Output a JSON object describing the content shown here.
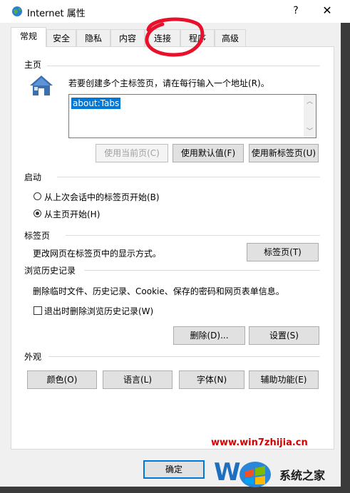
{
  "window": {
    "title": "Internet 属性",
    "help_label": "?",
    "close_label": "✕"
  },
  "tabs": [
    {
      "label": "常规",
      "active": true
    },
    {
      "label": "安全"
    },
    {
      "label": "隐私"
    },
    {
      "label": "内容"
    },
    {
      "label": "连接"
    },
    {
      "label": "程序"
    },
    {
      "label": "高级"
    }
  ],
  "homepage": {
    "title": "主页",
    "description": "若要创建多个主标签页，请在每行输入一个地址(R)。",
    "value": "about:Tabs",
    "buttons": {
      "use_current": "使用当前页(C)",
      "use_default": "使用默认值(F)",
      "use_new_tab": "使用新标签页(U)"
    }
  },
  "startup": {
    "title": "启动",
    "options": [
      {
        "label": "从上次会话中的标签页开始(B)",
        "selected": false
      },
      {
        "label": "从主页开始(H)",
        "selected": true
      }
    ]
  },
  "tabs_section": {
    "title": "标签页",
    "description": "更改网页在标签页中的显示方式。",
    "button": "标签页(T)"
  },
  "history": {
    "title": "浏览历史记录",
    "description": "删除临时文件、历史记录、Cookie、保存的密码和网页表单信息。",
    "checkbox_label": "退出时删除浏览历史记录(W)",
    "checked": false,
    "delete_button": "删除(D)...",
    "settings_button": "设置(S)"
  },
  "appearance": {
    "title": "外观",
    "buttons": [
      "颜色(O)",
      "语言(L)",
      "字体(N)",
      "辅助功能(E)"
    ]
  },
  "footer": {
    "ok_button": "确定"
  },
  "watermark": {
    "url": "www.win7zhijia.cn",
    "logo_text": "系统之家"
  },
  "colors": {
    "accent": "#0078d7",
    "annotation": "#e8102a"
  }
}
